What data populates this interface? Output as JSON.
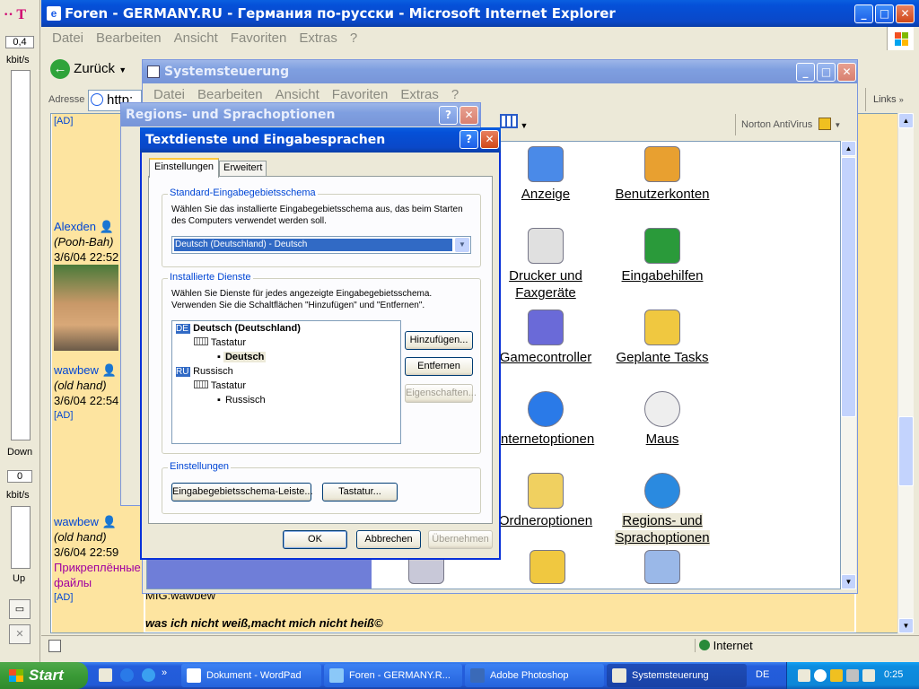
{
  "meter": {
    "top_value": "0,4",
    "top_unit": "kbit/s",
    "down_label": "Down",
    "mid_value": "0",
    "mid_unit": "kbit/s",
    "up_label": "Up"
  },
  "ie": {
    "title": "Foren - GERMANY.RU - Германия по-русски - Microsoft Internet Explorer",
    "menu": [
      "Datei",
      "Bearbeiten",
      "Ansicht",
      "Favoriten",
      "Extras",
      "?"
    ],
    "back_label": "Zurück",
    "address_label": "Adresse",
    "address_value": "http:",
    "links_label": "Links",
    "status_zone": "Internet",
    "footer_sig": "MIG:wawbew",
    "footer_text": "was ich nicht weiß,macht mich nicht heiß©"
  },
  "forum": {
    "ad_top": "[AD]",
    "posts": [
      {
        "name": "Alexden",
        "rank": "(Pooh-Bah)",
        "date": "3/6/04 22:52"
      },
      {
        "name": "wawbew",
        "rank": "(old hand)",
        "date": "3/6/04 22:54",
        "extra": "[AD]"
      },
      {
        "name": "wawbew",
        "rank": "(old hand)",
        "date": "3/6/04 22:59",
        "attach": "Прикреплённые файлы",
        "extra": "[AD]"
      }
    ]
  },
  "cp": {
    "title": "Systemsteuerung",
    "menu": [
      "Datei",
      "Bearbeiten",
      "Ansicht",
      "Favoriten",
      "Extras",
      "?"
    ],
    "norton": "Norton AntiVirus",
    "items": [
      {
        "label": "Anzeige",
        "icon": "display-icon"
      },
      {
        "label": "Benutzerkonten",
        "icon": "users-icon"
      },
      {
        "label": "Drucker und Faxgeräte",
        "icon": "printer-icon"
      },
      {
        "label": "Eingabehilfen",
        "icon": "accessibility-icon"
      },
      {
        "label": "Gamecontroller",
        "icon": "gamepad-icon"
      },
      {
        "label": "Geplante Tasks",
        "icon": "scheduled-tasks-icon"
      },
      {
        "label": "Internetoptionen",
        "icon": "globe-icon"
      },
      {
        "label": "Maus",
        "icon": "mouse-icon"
      },
      {
        "label": "Ordneroptionen",
        "icon": "folder-options-icon"
      },
      {
        "label": "Regions- und Sprachoptionen",
        "icon": "regional-globe-icon"
      }
    ]
  },
  "regions": {
    "title": "Regions- und Sprachoptionen"
  },
  "dialog": {
    "title": "Textdienste und Eingabesprachen",
    "tabs": [
      "Einstellungen",
      "Erweitert"
    ],
    "group1_label": "Standard-Eingabegebietsschema",
    "group1_text": "Wählen Sie das installierte Eingabegebietsschema aus, das beim Starten des Computers verwendet werden soll.",
    "select_value": "Deutsch (Deutschland) - Deutsch",
    "group2_label": "Installierte Dienste",
    "group2_text": "Wählen Sie Dienste für jedes angezeigte Eingabegebietsschema. Verwenden Sie die Schaltflächen \"Hinzufügen\" und \"Entfernen\".",
    "tree": {
      "lang1_badge": "DE",
      "lang1": "Deutsch (Deutschland)",
      "kb1": "Tastatur",
      "layout1": "Deutsch",
      "lang2_badge": "RU",
      "lang2": "Russisch",
      "kb2": "Tastatur",
      "layout2": "Russisch"
    },
    "btn_add": "Hinzufügen...",
    "btn_remove": "Entfernen",
    "btn_props": "Eigenschaften...",
    "group3_label": "Einstellungen",
    "btn_langbar": "Eingabegebietsschema-Leiste...",
    "btn_keys": "Tastatur...",
    "btn_ok": "OK",
    "btn_cancel": "Abbrechen",
    "btn_apply": "Übernehmen"
  },
  "taskbar": {
    "start": "Start",
    "tasks": [
      "Dokument - WordPad",
      "Foren - GERMANY.R...",
      "Adobe Photoshop",
      "Systemsteuerung"
    ],
    "lang": "DE",
    "clock": "0:25"
  }
}
